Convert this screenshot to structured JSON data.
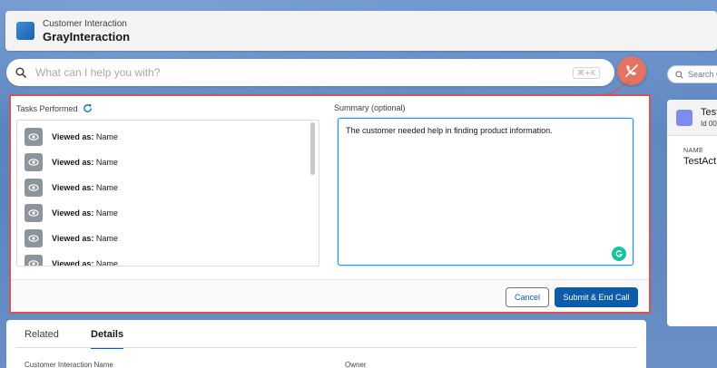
{
  "header": {
    "subtitle": "Customer Interaction",
    "title": "GrayInteraction"
  },
  "search": {
    "placeholder": "What can I help you with?",
    "shortcut": "⌘+K"
  },
  "tasks": {
    "label": "Tasks Performed",
    "items": [
      {
        "bold": "Viewed as:",
        "text": "Name"
      },
      {
        "bold": "Viewed as:",
        "text": "Name"
      },
      {
        "bold": "Viewed as:",
        "text": "Name"
      },
      {
        "bold": "Viewed as:",
        "text": "Name"
      },
      {
        "bold": "Viewed as:",
        "text": "Name"
      },
      {
        "bold": "Viewed as:",
        "text": "Name"
      }
    ]
  },
  "summary": {
    "label": "Summary (optional)",
    "value": "The customer needed help in finding product information."
  },
  "footer": {
    "cancel_label": "Cancel",
    "submit_label": "Submit & End Call"
  },
  "tabs": {
    "related": "Related",
    "details": "Details",
    "field_name": "Customer Interaction Name",
    "field_owner": "Owner"
  },
  "right_panel": {
    "search_placeholder": "Search C",
    "card_title": "Test",
    "card_id": "Id 00",
    "name_label": "NAME",
    "name_value": "TestAct"
  },
  "colors": {
    "accent": "#0b5cab",
    "highlight_border": "#d9534f",
    "end_call": "#e57361"
  }
}
